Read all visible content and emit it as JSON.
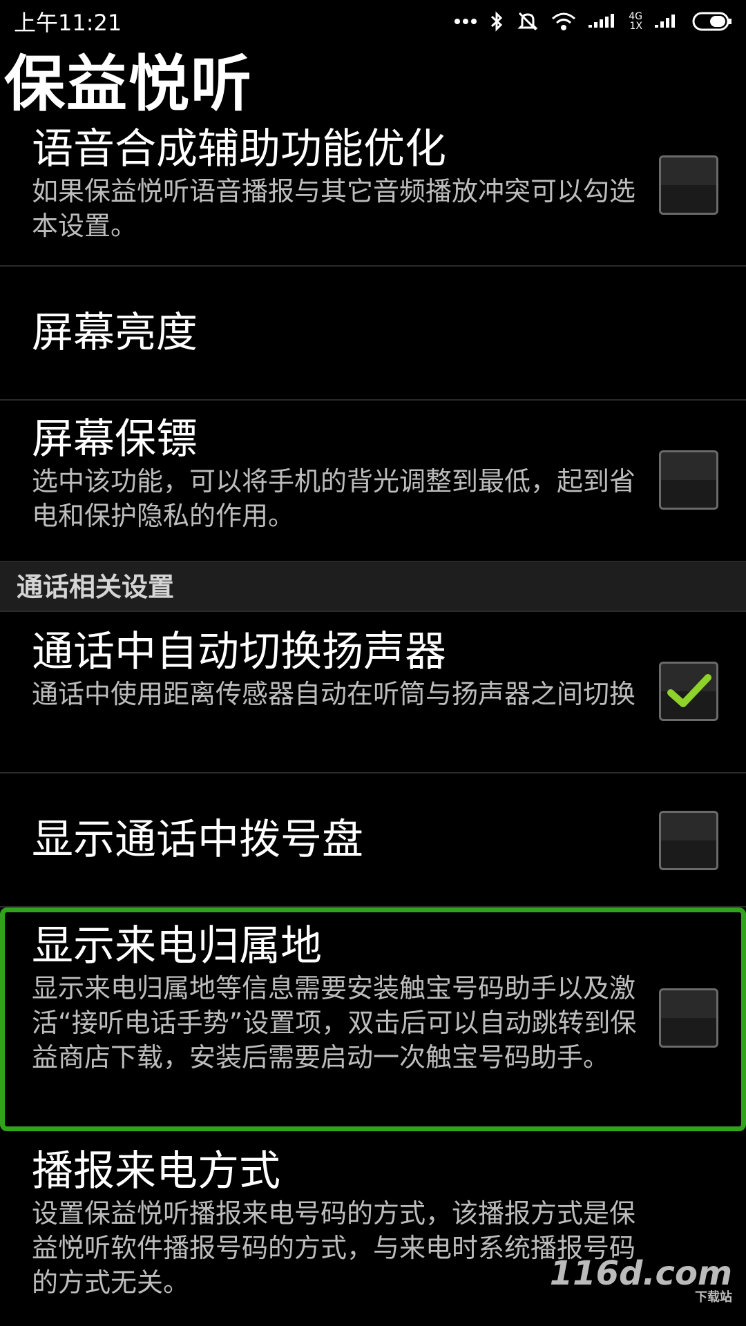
{
  "status_bar": {
    "time": "上午11:21",
    "network_top": "4G",
    "network_bottom": "1X",
    "icons": [
      "more-dots-icon",
      "bluetooth-icon",
      "mute-icon",
      "wifi-icon",
      "signal-bars-icon",
      "signal-bars-icon",
      "battery-icon"
    ]
  },
  "app": {
    "title": "保益悦听"
  },
  "settings": [
    {
      "title": "语音合成辅助功能优化",
      "desc": "如果保益悦听语音播报与其它音频播放冲突可以勾选本设置。",
      "checked": false
    },
    {
      "title": "屏幕亮度",
      "desc": ""
    },
    {
      "title": "屏幕保镖",
      "desc": "选中该功能，可以将手机的背光调整到最低，起到省电和保护隐私的作用。",
      "checked": false
    }
  ],
  "section": {
    "title": "通话相关设置"
  },
  "call_settings": [
    {
      "title": "通话中自动切换扬声器",
      "desc": "通话中使用距离传感器自动在听筒与扬声器之间切换",
      "checked": true
    },
    {
      "title": "显示通话中拨号盘",
      "desc": "",
      "checked": false
    },
    {
      "title": "显示来电归属地",
      "desc": "显示来电归属地等信息需要安装触宝号码助手以及激活“接听电话手势”设置项，双击后可以自动跳转到保益商店下载，安装后需要启动一次触宝号码助手。",
      "checked": false
    },
    {
      "title": "播报来电方式",
      "desc": "设置保益悦听播报来电号码的方式，该播报方式是保益悦听软件播报号码的方式，与来电时系统播报号码的方式无关。"
    }
  ],
  "watermark": {
    "main": "116d.com",
    "sub": "下载站"
  },
  "colors": {
    "highlight": "#2fa31a",
    "check": "#8fd32a"
  }
}
